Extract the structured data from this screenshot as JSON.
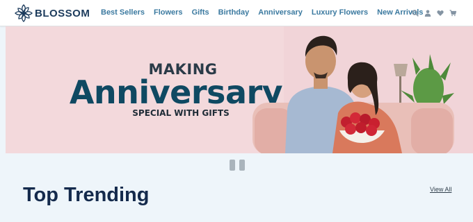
{
  "brand": {
    "name": "BLOSSOM",
    "color": "#1c3b5c"
  },
  "nav": {
    "items": [
      "Best Sellers",
      "Flowers",
      "Gifts",
      "Birthday",
      "Anniversary",
      "Luxury Flowers",
      "New Arrivals"
    ],
    "link_color": "#3c7aa0",
    "icons": [
      "search-icon",
      "user-icon",
      "heart-icon",
      "cart-icon"
    ]
  },
  "banner": {
    "line1": "MAKING",
    "line2": "Anniversary",
    "line3": "SPECIAL WITH GIFTS",
    "background": "#f3d9dc",
    "accent": "#0f4962"
  },
  "carousel": {
    "control": "pause-icon"
  },
  "section": {
    "title": "Top Trending",
    "view_all": "View All"
  }
}
